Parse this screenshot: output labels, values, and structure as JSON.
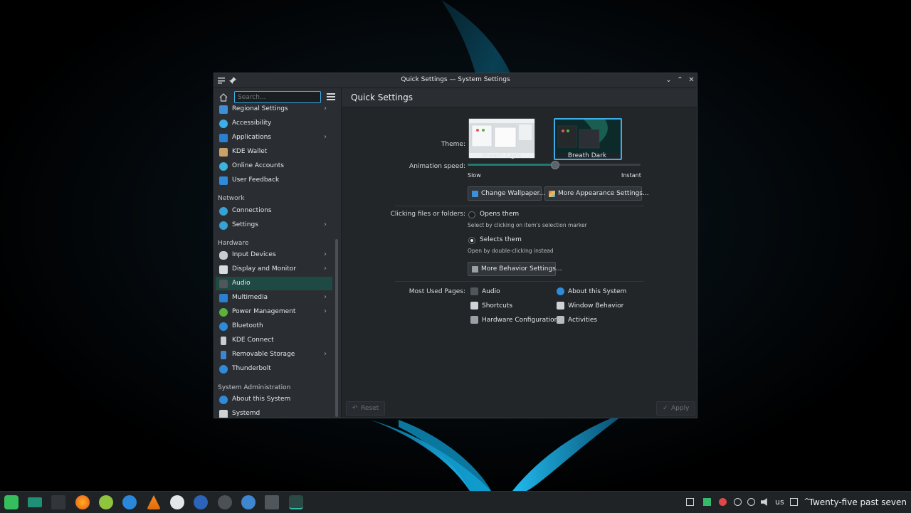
{
  "window": {
    "title": "Quick Settings — System Settings"
  },
  "sidebar": {
    "search_placeholder": "Search...",
    "items": [
      {
        "label": "Regional Settings",
        "icon": "flag-icon",
        "color": "#3d8fd8",
        "arrow": true
      },
      {
        "label": "Accessibility",
        "icon": "accessibility-icon",
        "color": "#3daee9",
        "arrow": false
      },
      {
        "label": "Applications",
        "icon": "applications-icon",
        "color": "#2b7fd1",
        "arrow": true
      },
      {
        "label": "KDE Wallet",
        "icon": "wallet-icon",
        "color": "#c9a26a",
        "arrow": false
      },
      {
        "label": "Online Accounts",
        "icon": "online-accounts-icon",
        "color": "#3fb2d9",
        "arrow": false
      },
      {
        "label": "User Feedback",
        "icon": "feedback-icon",
        "color": "#2f8ad9",
        "arrow": false
      }
    ],
    "network_label": "Network",
    "network_items": [
      {
        "label": "Connections",
        "icon": "globe-icon",
        "color": "#35a3d6",
        "arrow": false
      },
      {
        "label": "Settings",
        "icon": "globe-icon",
        "color": "#35a3d6",
        "arrow": true
      }
    ],
    "hardware_label": "Hardware",
    "hardware_items": [
      {
        "label": "Input Devices",
        "icon": "mouse-icon",
        "color": "#c9ccd0",
        "arrow": true
      },
      {
        "label": "Display and Monitor",
        "icon": "monitor-icon",
        "color": "#d9dcdf",
        "arrow": true
      },
      {
        "label": "Audio",
        "icon": "speaker-icon",
        "color": "#4f565c",
        "arrow": false
      },
      {
        "label": "Multimedia",
        "icon": "multimedia-icon",
        "color": "#2b7fd1",
        "arrow": true
      },
      {
        "label": "Power Management",
        "icon": "power-icon",
        "color": "#5bb33c",
        "arrow": true
      },
      {
        "label": "Bluetooth",
        "icon": "bluetooth-icon",
        "color": "#2f8ad9",
        "arrow": false
      },
      {
        "label": "KDE Connect",
        "icon": "phone-icon",
        "color": "#c9ccd0",
        "arrow": false
      },
      {
        "label": "Removable Storage",
        "icon": "usb-icon",
        "color": "#3f86d1",
        "arrow": true
      },
      {
        "label": "Thunderbolt",
        "icon": "thunderbolt-icon",
        "color": "#2f8ad9",
        "arrow": false
      }
    ],
    "sysadmin_label": "System Administration",
    "sysadmin_items": [
      {
        "label": "About this System",
        "icon": "info-icon",
        "color": "#2f8ad9",
        "arrow": false
      },
      {
        "label": "Systemd",
        "icon": "systemd-icon",
        "color": "#cfd3d6",
        "arrow": false
      }
    ]
  },
  "main": {
    "title": "Quick Settings",
    "theme_label": "Theme:",
    "themes": [
      {
        "caption": "Breath Light",
        "selected": false
      },
      {
        "caption": "Breath Dark",
        "selected": true
      }
    ],
    "animation_label": "Animation speed:",
    "animation_speed": 0.5,
    "slow_label": "Slow",
    "instant_label": "Instant",
    "change_wallpaper": "Change Wallpaper...",
    "more_appearance": "More Appearance Settings...",
    "clicking_label": "Clicking files or folders:",
    "opens_them": "Opens them",
    "opens_hint": "Select by clicking on item's selection marker",
    "selects_them": "Selects them",
    "selects_hint": "Open by double-clicking instead",
    "selected_click_mode": "Selects them",
    "more_behavior": "More Behavior Settings...",
    "most_used_label": "Most Used Pages:",
    "most_used": [
      {
        "label": "Audio",
        "icon": "speaker-icon"
      },
      {
        "label": "About this System",
        "icon": "info-icon"
      },
      {
        "label": "Shortcuts",
        "icon": "keyboard-icon"
      },
      {
        "label": "Window Behavior",
        "icon": "window-icon"
      },
      {
        "label": "Hardware Configuration",
        "icon": "hardware-icon"
      },
      {
        "label": "Activities",
        "icon": "activities-icon"
      }
    ],
    "reset": "Reset",
    "apply": "Apply"
  },
  "taskbar": {
    "keyboard_layout": "us",
    "clock": "Twenty-five past seven"
  },
  "colors": {
    "accent": "#3daee9",
    "selection": "#1f4a44",
    "slider_fill": "#1f7a70"
  }
}
